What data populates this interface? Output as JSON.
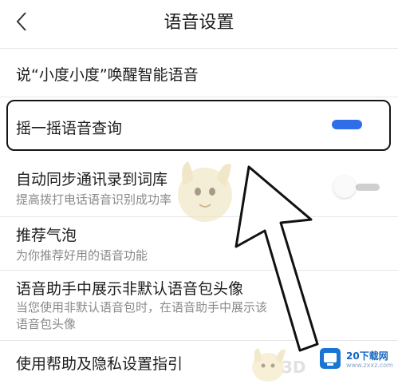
{
  "header": {
    "title": "语音设置",
    "back_icon": "chevron-left-icon"
  },
  "settings": [
    {
      "label": "说“小度小度”唤醒智能语音"
    },
    {
      "label": "摇一摇语音查询",
      "toggle": "on"
    },
    {
      "label": "自动同步通讯录到词库",
      "sub": "提高拨打电话语音识别成功率",
      "toggle": "off"
    },
    {
      "label": "推荐气泡",
      "sub": "为你推荐好用的语音功能"
    },
    {
      "label": "语音助手中展示非默认语音包头像",
      "sub_lines": [
        "当您使用非默认语音包时，在语音助手中展示该",
        "语音包头像"
      ]
    },
    {
      "label": "使用帮助及隐私设置指引"
    }
  ],
  "watermark": {
    "site_name": "20下载网",
    "site_url": "www.zxxz.com",
    "overlay_text": "3D"
  },
  "colors": {
    "accent": "#2f6ee8",
    "toggle_off": "#cfcfcf",
    "divider": "#e6e6e6"
  }
}
